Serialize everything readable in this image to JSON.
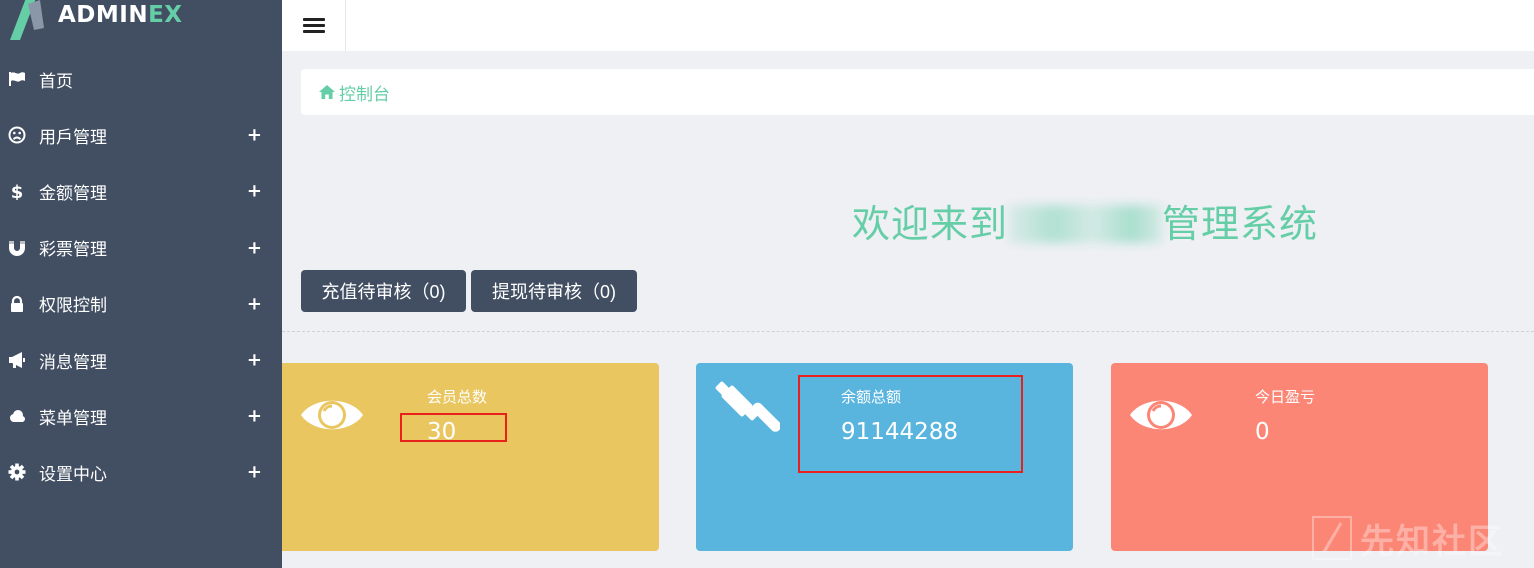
{
  "app": {
    "logo_prefix": "ADMIN",
    "logo_suffix": "EX"
  },
  "sidebar": {
    "items": [
      {
        "label": "首页",
        "icon": "flag-icon",
        "expandable": false
      },
      {
        "label": "用戶管理",
        "icon": "frown-icon",
        "expandable": true,
        "expand_symbol": "+"
      },
      {
        "label": "金额管理",
        "icon": "dollar-icon",
        "expandable": true,
        "expand_symbol": "+"
      },
      {
        "label": "彩票管理",
        "icon": "magnet-icon",
        "expandable": true,
        "expand_symbol": "+"
      },
      {
        "label": "权限控制",
        "icon": "lock-icon",
        "expandable": true,
        "expand_symbol": "+"
      },
      {
        "label": "消息管理",
        "icon": "bullhorn-icon",
        "expandable": true,
        "expand_symbol": "+"
      },
      {
        "label": "菜单管理",
        "icon": "cloud-icon",
        "expandable": true,
        "expand_symbol": "+"
      },
      {
        "label": "设置中心",
        "icon": "gear-icon",
        "expandable": true,
        "expand_symbol": "+"
      }
    ]
  },
  "header": {
    "toggle_icon": "hamburger-icon"
  },
  "breadcrumb": {
    "icon": "home-icon",
    "label": "控制台"
  },
  "welcome": {
    "prefix": "欢迎来到",
    "suffix": "管理系统"
  },
  "actions": {
    "recharge_pending": "充值待审核（0)",
    "withdraw_pending": "提现待审核（0)"
  },
  "stats": [
    {
      "title": "会员总数",
      "value": "30",
      "icon": "eye-icon",
      "color": "#e9c660"
    },
    {
      "title": "余额总额",
      "value": "91144288",
      "icon": "gavel-icon",
      "color": "#5ab5de"
    },
    {
      "title": "今日盈亏",
      "value": "0",
      "icon": "eye-icon",
      "color": "#fc8675"
    }
  ],
  "colors": {
    "sidebar_bg": "#424f63",
    "accent": "#65cea7",
    "page_bg": "#eff0f4",
    "highlight_box": "#e8211c"
  },
  "watermark": {
    "text": "先知社区"
  }
}
